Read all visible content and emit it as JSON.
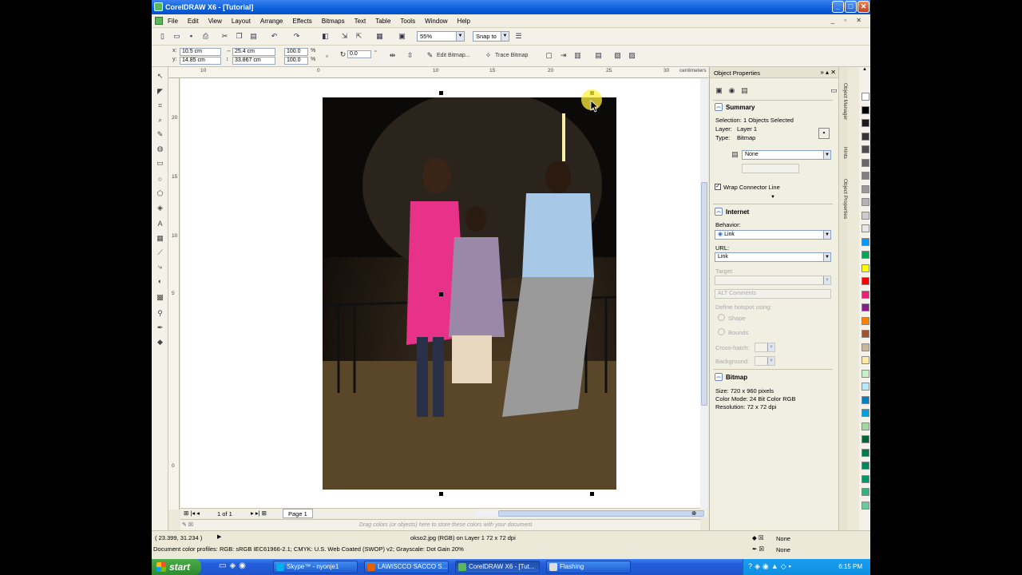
{
  "window": {
    "title": "CorelDRAW X6 - [Tutorial]"
  },
  "menu": [
    "File",
    "Edit",
    "View",
    "Layout",
    "Arrange",
    "Effects",
    "Bitmaps",
    "Text",
    "Table",
    "Tools",
    "Window",
    "Help"
  ],
  "toolbar": {
    "zoom": "55%",
    "snap_to": "Snap to"
  },
  "property_bar": {
    "x_label": "x:",
    "x": "10.5 cm",
    "y_label": "y:",
    "y": "14.85 cm",
    "width": "25.4 cm",
    "height": "33.867 cm",
    "scale_w": "100.0",
    "scale_h": "100.0",
    "percent": "%",
    "rotation": "0.0",
    "degree": "°",
    "edit_bitmap": "Edit Bitmap...",
    "trace_bitmap": "Trace Bitmap"
  },
  "rulers": {
    "unit": "centimeters",
    "h_ticks": [
      "10",
      "0",
      "5",
      "10",
      "15",
      "20",
      "25",
      "30"
    ],
    "v_ticks": [
      "20",
      "15",
      "10",
      "5",
      "0"
    ]
  },
  "pagenav": {
    "page_count": "1 of 1",
    "page_tab": "Page 1"
  },
  "palette_hint": "Drag colors (or objects) here to store these colors with your document",
  "docker": {
    "title": "Object Properties",
    "summary": {
      "title": "Summary",
      "selection": "Selection: 1 Objects Selected",
      "layer_label": "Layer:",
      "layer": "Layer 1",
      "type_label": "Type:",
      "type": "Bitmap",
      "wrap_value": "None",
      "wrap_connector": "Wrap Connector Line"
    },
    "internet": {
      "title": "Internet",
      "behavior_label": "Behavior:",
      "behavior": "Link",
      "url_label": "URL:",
      "url": "Link",
      "target_label": "Target:",
      "alt_placeholder": "ALT Comments",
      "hotspot_label": "Define hotspot using:",
      "shape": "Shape",
      "bounds": "Bounds",
      "crosshatch": "Cross-hatch:",
      "background": "Background:"
    },
    "bitmap": {
      "title": "Bitmap",
      "size": "Size:        720 x 960 pixels",
      "color_mode": "Color Mode: 24 Bit Color  RGB",
      "resolution": "Resolution:  72 x 72 dpi"
    }
  },
  "side_tabs": [
    "Object Manager",
    "Hints",
    "Object Properties"
  ],
  "palette_colors": [
    "#ffffff",
    "#000000",
    "#1a1a1a",
    "#333333",
    "#4d4d4d",
    "#666666",
    "#808080",
    "#999999",
    "#b3b3b3",
    "#cccccc",
    "#e6e6e6",
    "#0099ff",
    "#00a651",
    "#ffff00",
    "#ff0000",
    "#ed1c7b",
    "#8b1a8b",
    "#ff7f00",
    "#a0522d",
    "#c8b89a",
    "#fbeaa8",
    "#c8f0c8",
    "#b8e8f8",
    "#0080c0",
    "#00a0e0",
    "#a0d8a0",
    "#006633",
    "#007a4d",
    "#00875a",
    "#009966",
    "#33b380",
    "#66cc99"
  ],
  "status": {
    "coords": "( 23.399, 31.234 )",
    "object_info": "okso2.jpg (RGB) on Layer 1 72 x 72 dpi",
    "profiles": "Document color profiles: RGB: sRGB IEC61966-2.1; CMYK: U.S. Web Coated (SWOP) v2; Grayscale: Dot Gain 20%",
    "fill": "None",
    "outline": "None"
  },
  "taskbar": {
    "start": "start",
    "tasks": [
      "Skype™ - nyonje1",
      "LAWISCCO SACCO S...",
      "CorelDRAW X6 - [Tut...",
      "Flashing"
    ],
    "time": "6:15 PM"
  }
}
